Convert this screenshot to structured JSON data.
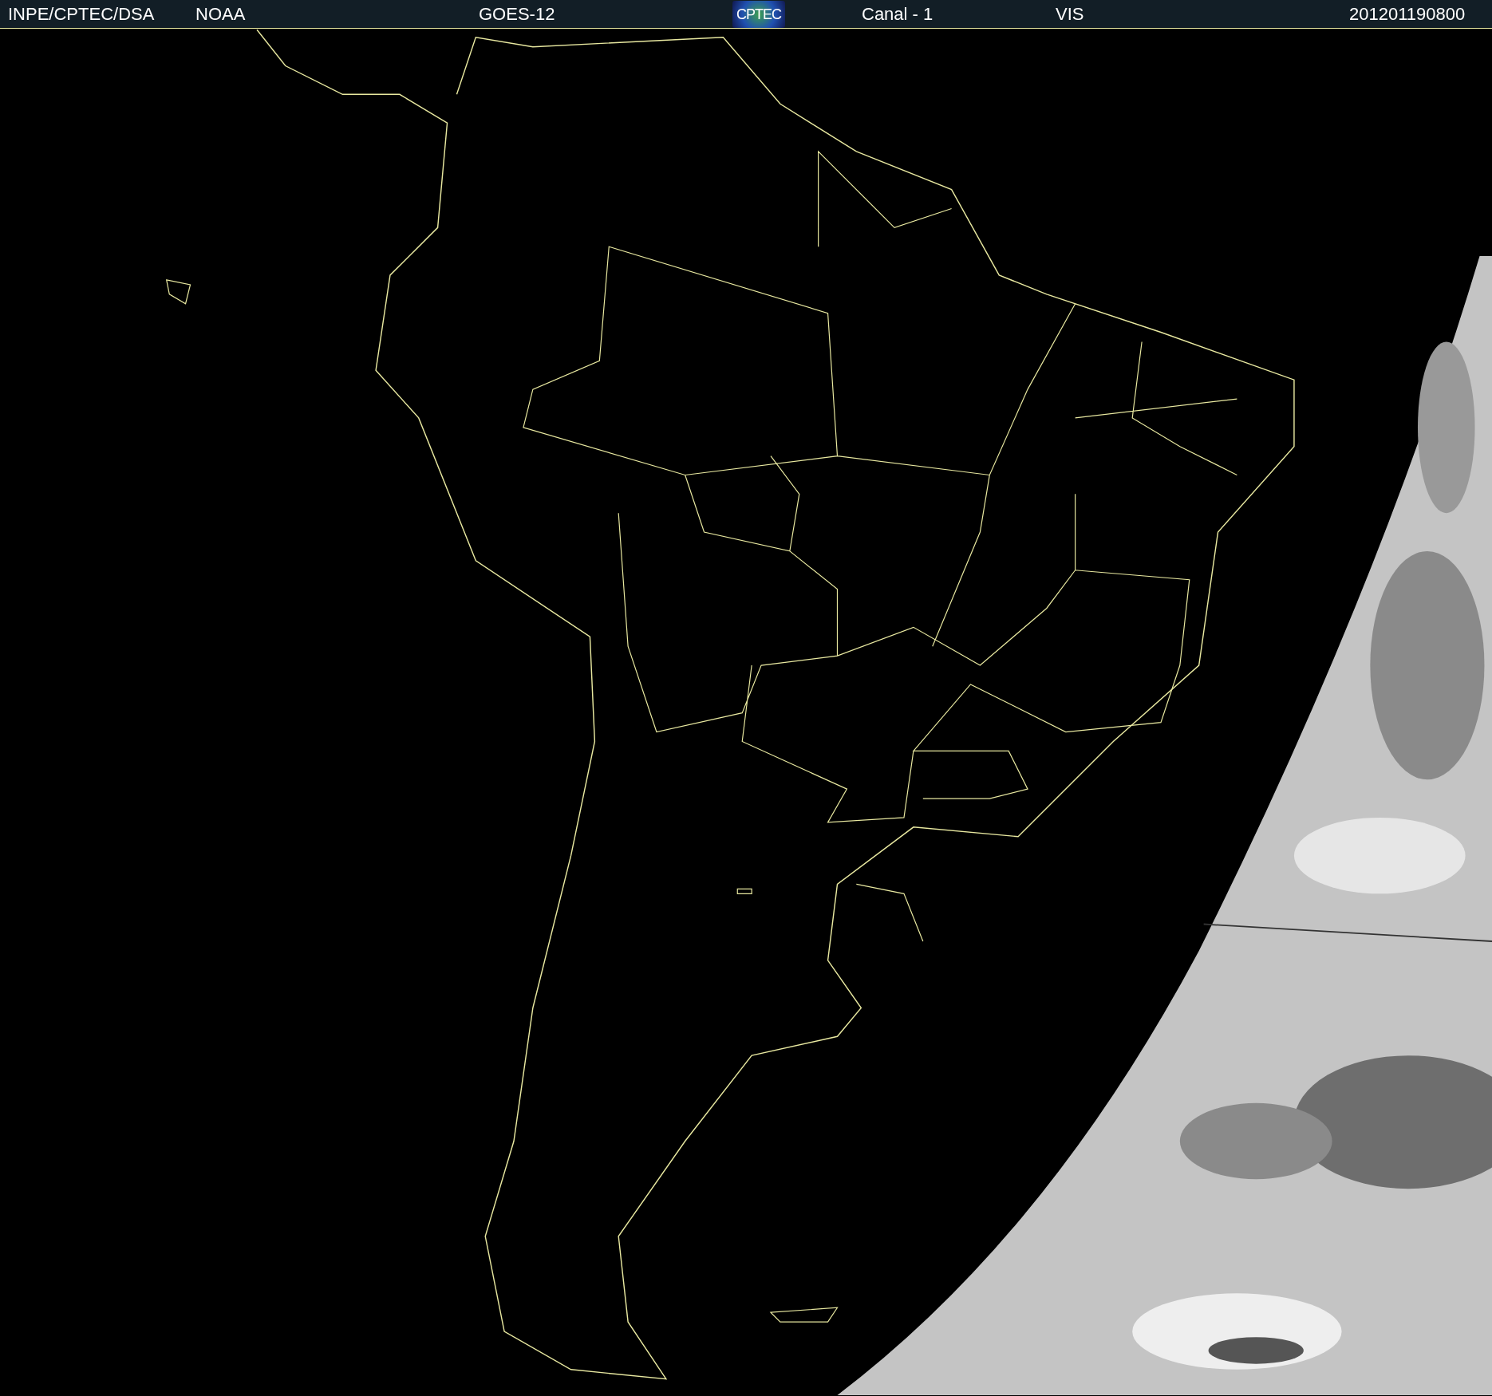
{
  "header": {
    "items": [
      {
        "kind": "text",
        "text": "INPE/CPTEC/DSA"
      },
      {
        "kind": "text",
        "text": "NOAA"
      },
      {
        "kind": "text",
        "text": "GOES-12"
      },
      {
        "kind": "logo",
        "text": "CPTEC"
      },
      {
        "kind": "text",
        "text": "Canal - 1"
      },
      {
        "kind": "text",
        "text": "VIS"
      },
      {
        "kind": "text",
        "text": "201201190800"
      }
    ]
  }
}
